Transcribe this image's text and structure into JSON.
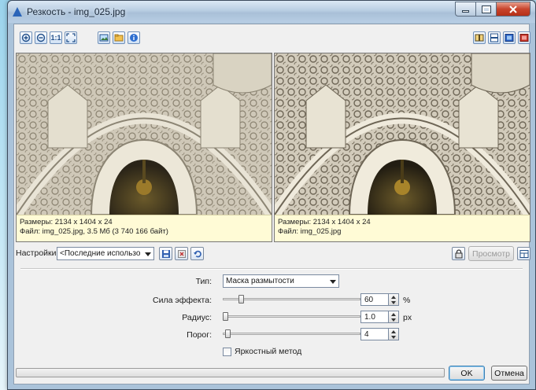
{
  "window": {
    "title": "Резкость - img_025.jpg"
  },
  "toolbar": {
    "left_icons": [
      "zoom-in-icon",
      "zoom-out-icon",
      "actual-size-icon",
      "fit-window-icon",
      "image-compare-icon",
      "folder-image-icon",
      "info-icon"
    ],
    "actual_size_label": "1:1",
    "right_icons": [
      "split-vertical-icon",
      "split-horizontal-icon",
      "single-before-icon",
      "single-after-icon"
    ]
  },
  "preview_left": {
    "size_line": "Размеры: 2134 x 1404 x 24",
    "file_line": "Файл: img_025.jpg, 3.5 Мб (3 740 166 байт)"
  },
  "preview_right": {
    "size_line": "Размеры: 2134 x 1404 x 24",
    "file_line": "Файл: img_025.jpg"
  },
  "settings": {
    "label": "Настройки:",
    "preset_value": "<Последние использо",
    "preview_button": "Просмотр"
  },
  "params": {
    "type_label": "Тип:",
    "type_value": "Маска размытости",
    "strength_label": "Сила эффекта:",
    "strength_value": "60",
    "strength_unit": "%",
    "strength_level": 0.12,
    "radius_label": "Радиус:",
    "radius_value": "1.0",
    "radius_unit": "px",
    "radius_level": 0.0,
    "threshold_label": "Порог:",
    "threshold_value": "4",
    "threshold_level": 0.02,
    "luma_checkbox_label": "Яркостный метод",
    "luma_checked": false
  },
  "footer": {
    "ok_label": "OK",
    "cancel_label": "Отмена"
  },
  "colors": {
    "info_background": "#fffbd6",
    "title_icon": "#2a64b8",
    "close_button": "#c8442c"
  }
}
